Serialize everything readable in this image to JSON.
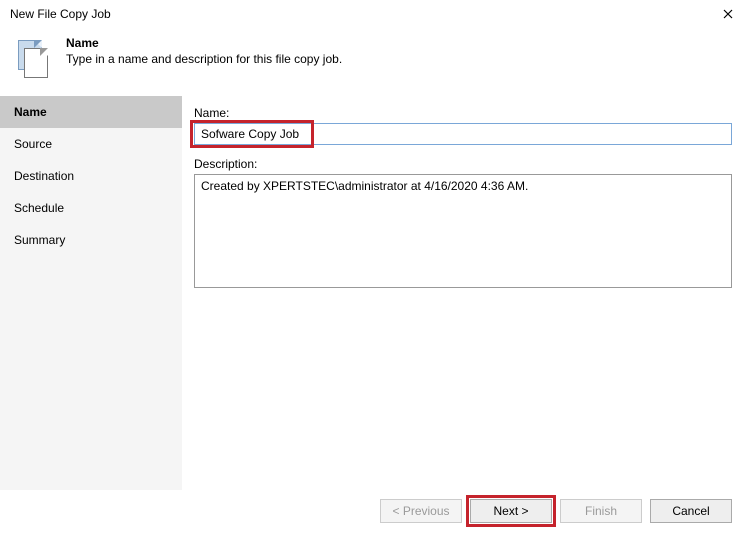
{
  "window": {
    "title": "New File Copy Job"
  },
  "header": {
    "name": "Name",
    "desc": "Type in a name and description for this file copy job."
  },
  "sidebar": {
    "items": [
      {
        "label": "Name"
      },
      {
        "label": "Source"
      },
      {
        "label": "Destination"
      },
      {
        "label": "Schedule"
      },
      {
        "label": "Summary"
      }
    ]
  },
  "form": {
    "name_label": "Name:",
    "name_value": "Sofware Copy Job",
    "desc_label": "Description:",
    "desc_value": "Created by XPERTSTEC\\administrator at 4/16/2020 4:36 AM."
  },
  "buttons": {
    "previous": "< Previous",
    "next": "Next >",
    "finish": "Finish",
    "cancel": "Cancel"
  }
}
